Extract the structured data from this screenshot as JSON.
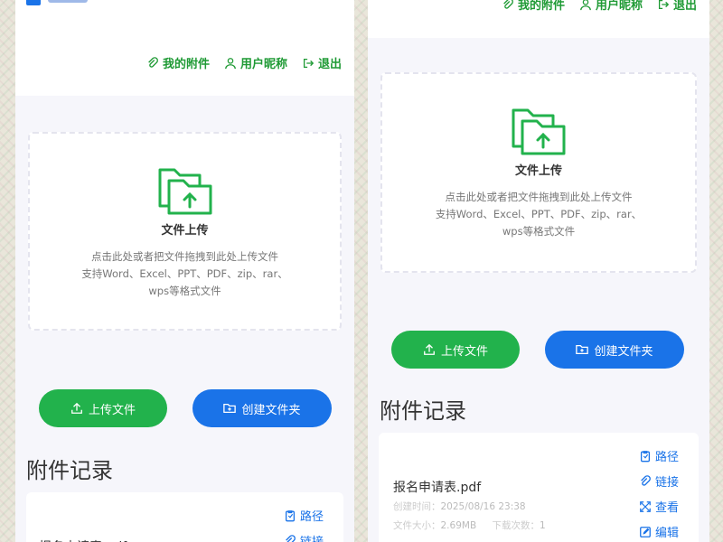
{
  "nav": {
    "attachments": "我的附件",
    "nickname": "用户昵称",
    "logout": "退出"
  },
  "upload": {
    "title": "文件上传",
    "hint_line1": "点击此处或者把文件拖拽到此处上传文件",
    "hint_line2": "支持Word、Excel、PPT、PDF、zip、rar、",
    "hint_line3": "wps等格式文件"
  },
  "buttons": {
    "upload": "上传文件",
    "create_folder": "创建文件夹"
  },
  "records": {
    "title": "附件记录",
    "file": {
      "name": "报名申请表.pdf",
      "created_label": "创建时间：",
      "created_value": "2025/08/16 23:38",
      "size_label": "文件大小：",
      "size_value": "2.69MB",
      "downloads_label": "下载次数：",
      "downloads_value": "1"
    },
    "actions": {
      "path": "路径",
      "link": "链接",
      "view": "查看",
      "edit": "编辑"
    }
  },
  "colors": {
    "accent_green": "#22b24c",
    "nav_green": "#1f9a35",
    "accent_blue": "#1a73e8"
  },
  "icons": {
    "attachments": "paperclip-icon",
    "nickname": "user-icon",
    "logout": "logout-icon",
    "upload_zone": "folder-upload-icon",
    "upload_button": "upload-icon",
    "create_folder_button": "folder-add-icon",
    "path": "clipboard-icon",
    "link": "link-icon",
    "view": "expand-icon",
    "edit": "edit-icon"
  }
}
